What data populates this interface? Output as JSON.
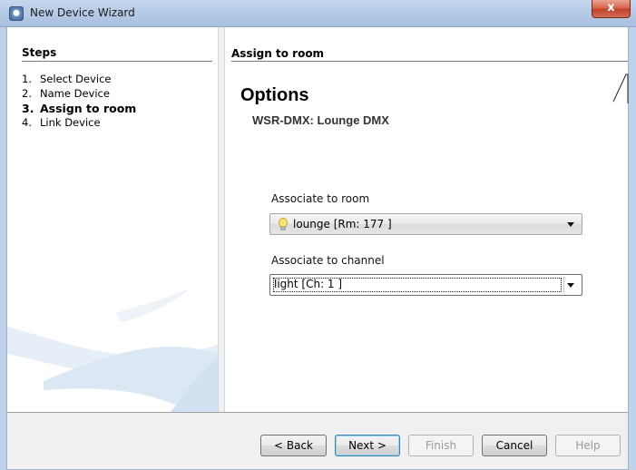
{
  "window": {
    "title": "New Device Wizard",
    "close_glyph": "x"
  },
  "steps": {
    "heading": "Steps",
    "items": [
      {
        "num": "1.",
        "label": "Select Device",
        "active": false
      },
      {
        "num": "2.",
        "label": "Name Device",
        "active": false
      },
      {
        "num": "3.",
        "label": "Assign to room",
        "active": true
      },
      {
        "num": "4.",
        "label": "Link Device",
        "active": false
      }
    ]
  },
  "page": {
    "heading": "Assign to room",
    "options_title": "Options",
    "device_subtitle": "WSR-DMX: Lounge DMX"
  },
  "room_field": {
    "label": "Associate to room",
    "selected": "lounge [Rm: 177 ]",
    "icon": "light-bulb-icon"
  },
  "channel_field": {
    "label": "Associate to channel",
    "selected": "light [Ch: 1 ]"
  },
  "buttons": {
    "back": "< Back",
    "next": "Next >",
    "finish": "Finish",
    "cancel": "Cancel",
    "help": "Help"
  },
  "colors": {
    "titlebar": "#b6cbe6",
    "close_button": "#c2432a",
    "default_button_border": "#3c7fb1"
  }
}
